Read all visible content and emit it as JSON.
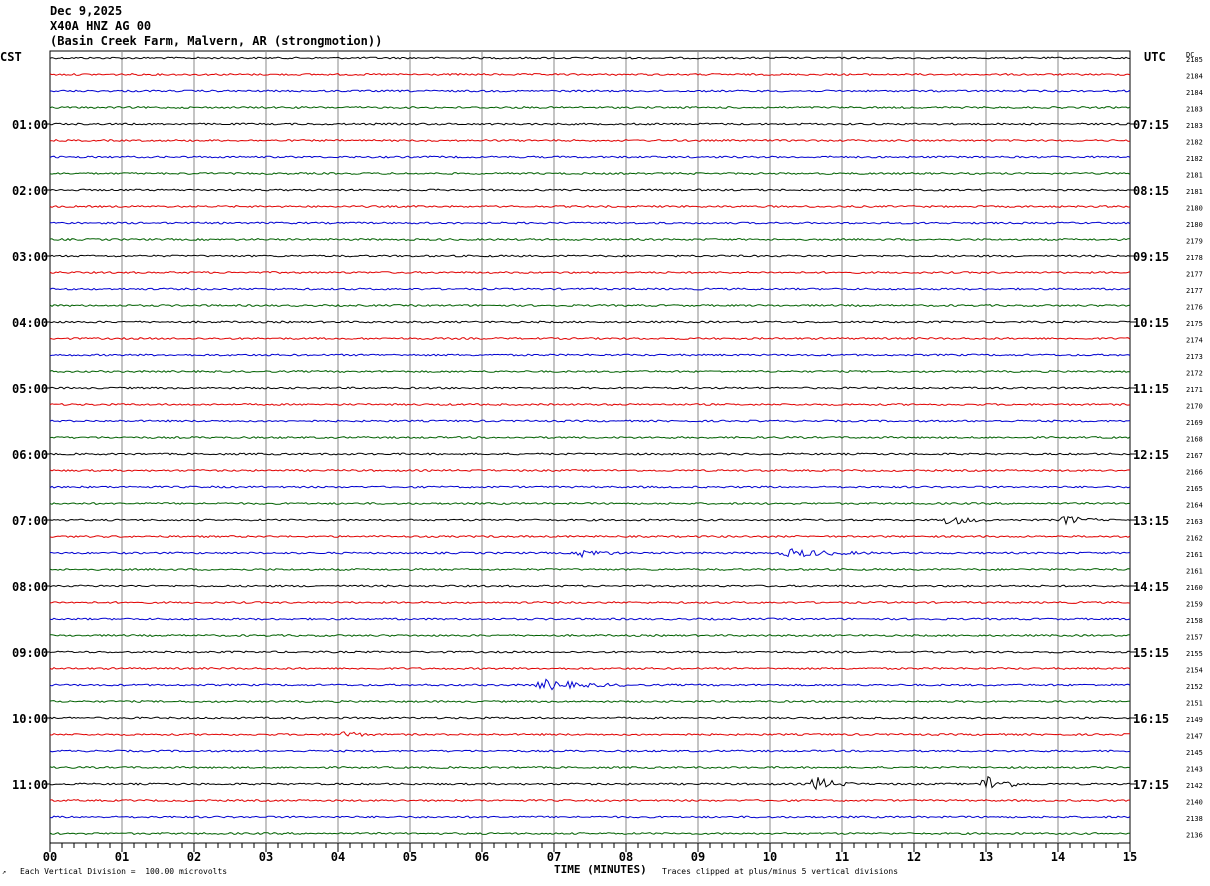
{
  "header": {
    "date": "Dec 9,2025",
    "station": "X40A HNZ AG 00",
    "location": "(Basin Creek Farm, Malvern, AR (strongmotion))"
  },
  "left_axis_label": "CST",
  "right_axis_label": "UTC",
  "dc_label": "DC",
  "footer": {
    "scale": "Each Vertical Division =  100.00 microvolts",
    "xlabel": "TIME (MINUTES)",
    "clip_note": "Traces clipped at plus/minus 5 vertical divisions"
  },
  "colors": {
    "trace_cycle": [
      "#000000",
      "#e00000",
      "#0000d0",
      "#006000"
    ],
    "grid": "#888888"
  },
  "chart_data": {
    "type": "line",
    "title": "X40A HNZ AG 00",
    "xlabel": "TIME (MINUTES)",
    "ylabel": "",
    "xlim": [
      0,
      15
    ],
    "x_ticks": [
      "00",
      "01",
      "02",
      "03",
      "04",
      "05",
      "06",
      "07",
      "08",
      "09",
      "10",
      "11",
      "12",
      "13",
      "14",
      "15"
    ],
    "cst_hour_labels": [
      "01:00",
      "02:00",
      "03:00",
      "04:00",
      "05:00",
      "06:00",
      "07:00",
      "08:00",
      "09:00",
      "10:00",
      "11:00"
    ],
    "utc_hour_labels": [
      "07:15",
      "08:15",
      "09:15",
      "10:15",
      "11:15",
      "12:15",
      "13:15",
      "14:15",
      "15:15",
      "16:15",
      "17:15"
    ],
    "dc_offsets": [
      2185,
      2184,
      2184,
      2183,
      2183,
      2182,
      2182,
      2181,
      2181,
      2180,
      2180,
      2179,
      2178,
      2177,
      2177,
      2176,
      2175,
      2174,
      2173,
      2172,
      2171,
      2170,
      2169,
      2168,
      2167,
      2166,
      2165,
      2164,
      2163,
      2162,
      2161,
      2161,
      2160,
      2159,
      2158,
      2157,
      2155,
      2154,
      2152,
      2151,
      2149,
      2147,
      2145,
      2143,
      2142,
      2140,
      2138,
      2136
    ],
    "events": [
      {
        "trace": 28,
        "start": 12.4,
        "end": 13.0,
        "amp": 6
      },
      {
        "trace": 28,
        "start": 14.0,
        "end": 14.6,
        "amp": 5
      },
      {
        "trace": 30,
        "start": 7.3,
        "end": 8.0,
        "amp": 4
      },
      {
        "trace": 30,
        "start": 10.1,
        "end": 11.5,
        "amp": 4
      },
      {
        "trace": 38,
        "start": 6.7,
        "end": 8.0,
        "amp": 5
      },
      {
        "trace": 41,
        "start": 4.0,
        "end": 4.5,
        "amp": 4
      },
      {
        "trace": 44,
        "start": 10.5,
        "end": 11.2,
        "amp": 8
      },
      {
        "trace": 44,
        "start": 12.9,
        "end": 13.6,
        "amp": 9
      }
    ]
  }
}
